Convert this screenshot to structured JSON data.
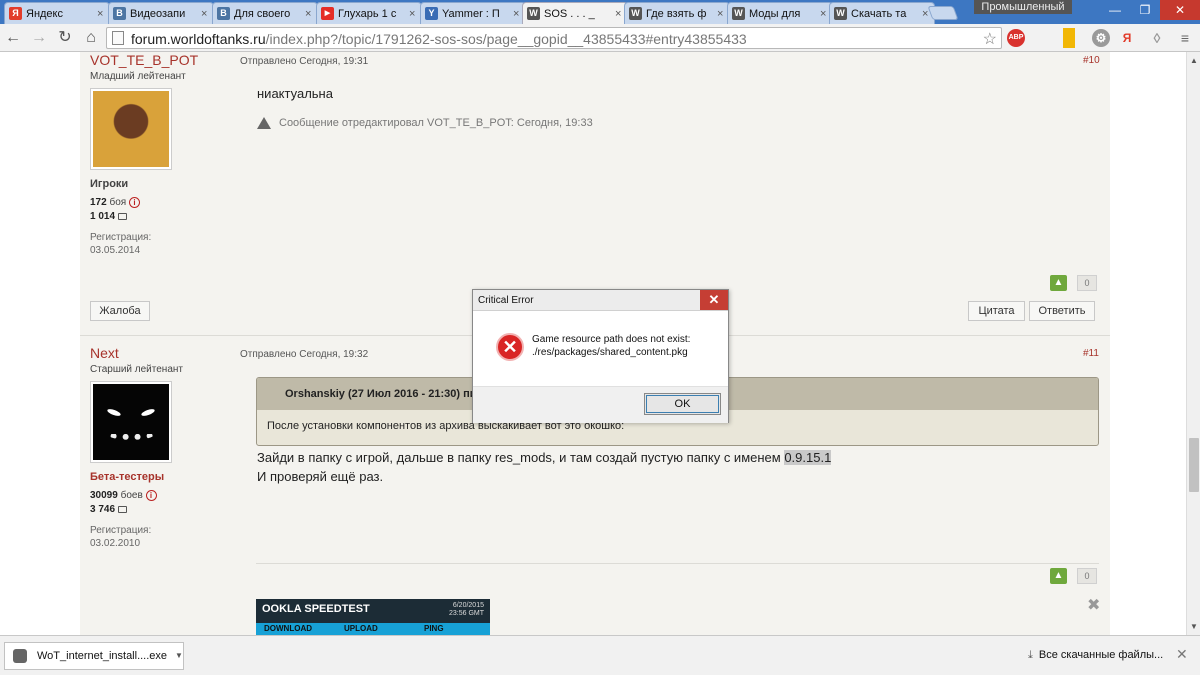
{
  "browser": {
    "tabs": [
      {
        "title": "Яндекс",
        "favicon_letter": "Я",
        "favicon_color": "#e23c2b",
        "active": false
      },
      {
        "title": "Видеозапи",
        "favicon_letter": "В",
        "favicon_color": "#4c75a3",
        "active": false
      },
      {
        "title": "Для своего",
        "favicon_letter": "В",
        "favicon_color": "#4c75a3",
        "active": false
      },
      {
        "title": "Глухарь 1 с",
        "favicon_letter": "▶",
        "favicon_color": "#e52d27",
        "active": false
      },
      {
        "title": "Yammer : П",
        "favicon_letter": "Y",
        "favicon_color": "#396cb5",
        "active": false
      },
      {
        "title": "SOS . . . _",
        "favicon_letter": "W",
        "favicon_color": "#555555",
        "active": true
      },
      {
        "title": "Где взять ф",
        "favicon_letter": "W",
        "favicon_color": "#555555",
        "active": false
      },
      {
        "title": "Моды для",
        "favicon_letter": "W",
        "favicon_color": "#555555",
        "active": false
      },
      {
        "title": "Скачать та",
        "favicon_letter": "W",
        "favicon_color": "#555555",
        "active": false
      }
    ],
    "profile_label": "Промышленный",
    "url_host": "forum.worldoftanks.ru",
    "url_path": "/index.php?/topic/1791262-sos-sos/page__gopid__43855433#entry43855433",
    "ext_abp": "ABP",
    "ext_ya": "Я"
  },
  "post10": {
    "username": "VOT_TE_B_POT",
    "rank": "Младший лейтенант",
    "group": "Игроки",
    "battles_num": "172",
    "battles_label": "боя",
    "posts": "1 014",
    "reg_label": "Регистрация:",
    "reg_date": "03.05.2014",
    "posted": "Отправлено Сегодня, 19:31",
    "number": "#10",
    "text": "ниактуальна",
    "edited": "Сообщение отредактировал VOT_TE_B_POT: Сегодня, 19:33",
    "votes": "0",
    "report_btn": "Жалоба",
    "quote_btn": "Цитата",
    "reply_btn": "Ответить"
  },
  "post11": {
    "username": "Next",
    "rank": "Старший лейтенант",
    "group": "Бета-тестеры",
    "battles_num": "30099",
    "battles_label": "боев",
    "posts": "3 746",
    "reg_label": "Регистрация:",
    "reg_date": "03.02.2010",
    "posted": "Отправлено Сегодня, 19:32",
    "number": "#11",
    "quote_header": "Orshanskiy (27 Июл 2016 - 21:30) пис",
    "quote_body": "После установки компонентов из архива выскакивает вот это окошко:",
    "line1_a": "Зайди в папку с игрой, дальше в папку res_mods, и там создай пустую папку с именем ",
    "line1_version": "0.9.15.1",
    "line2": "И проверяй ещё раз.",
    "votes": "0",
    "speedtest_logo": "OOKLA SPEEDTEST",
    "speedtest_date": "6/20/2015",
    "speedtest_time": "23:56 GMT",
    "speedtest_download": "DOWNLOAD",
    "speedtest_upload": "UPLOAD",
    "speedtest_ping": "PING"
  },
  "dialog": {
    "title": "Critical Error",
    "message_line1": "Game resource path does not exist:",
    "message_line2": "./res/packages/shared_content.pkg",
    "ok_label": "OK"
  },
  "downloads": {
    "file_name": "WoT_internet_install....exe",
    "show_all": "Все скачанные файлы..."
  },
  "colors": {
    "tabstrip": "#3d77c2",
    "username": "#a7332b",
    "dialog_close": "#c53e34",
    "vote_up": "#6fa83c"
  }
}
